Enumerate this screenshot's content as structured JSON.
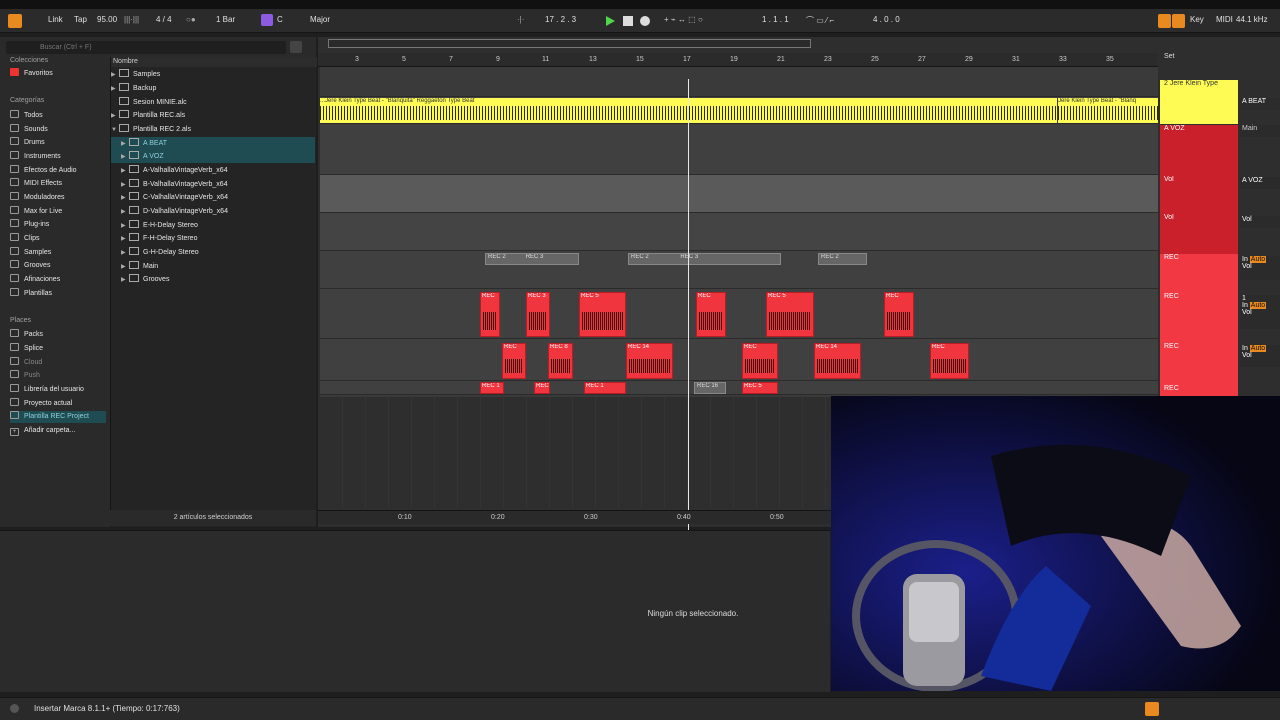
{
  "transport": {
    "link": "Link",
    "tap": "Tap",
    "tempo": "95.00",
    "meter": "4 / 4",
    "quant": "1 Bar",
    "key": "C",
    "scale": "Major",
    "position": "17 . 2 . 3",
    "loop_start": "1 . 1 . 1",
    "loop_len": "4 . 0 . 0",
    "key_label": "Key",
    "midi_label": "MIDI",
    "sample_rate": "44.1 kHz"
  },
  "browser": {
    "search_placeholder": "Buscar (Ctrl + F)",
    "collections_title": "Colecciones",
    "favorites": "Favoritos",
    "categories_title": "Categorías",
    "categories": [
      "Todos",
      "Sounds",
      "Drums",
      "Instruments",
      "Efectos de Audio",
      "MIDI Effects",
      "Moduladores",
      "Max for Live",
      "Plug-ins",
      "Clips",
      "Samples",
      "Grooves",
      "Afinaciones",
      "Plantillas"
    ],
    "places_title": "Places",
    "places": [
      "Packs",
      "Splice",
      "Cloud",
      "Push",
      "Librería del usuario",
      "Proyecto actual",
      "Plantilla REC Project",
      "Añadir carpeta..."
    ],
    "name_header": "Nombre",
    "files": [
      "Samples",
      "Backup",
      "Sesion MINIE.alc",
      "Plantilla REC.als",
      "Plantilla REC 2.als",
      "A BEAT",
      "A VOZ",
      "A-ValhallaVintageVerb_x64",
      "B-ValhallaVintageVerb_x64",
      "C-ValhallaVintageVerb_x64",
      "D-ValhallaVintageVerb_x64",
      "E-H-Delay Stereo",
      "F-H-Delay Stereo",
      "G-H-Delay Stereo",
      "Main",
      "Grooves"
    ],
    "status": "2 artículos seleccionados"
  },
  "ruler": {
    "bars": [
      "3",
      "5",
      "7",
      "9",
      "11",
      "13",
      "15",
      "17",
      "19",
      "21",
      "23",
      "25",
      "27",
      "29",
      "31",
      "33",
      "35"
    ],
    "set_label": "Set",
    "times": [
      "0:10",
      "0:20",
      "0:30",
      "0:40",
      "0:50"
    ]
  },
  "clips": {
    "beat_title": "...Jere Klein Type Beat - \"Blanquita\" Reggaeton Type Beat",
    "beat_title2": "Jere Klein Type Beat - \"Blanq",
    "rec2a": "REC 2",
    "rec3a": "REC 3",
    "rec2b": "REC 2",
    "rec3b": "REC 3",
    "rec2c": "REC 2",
    "red_labels": [
      "REC",
      "REC 3",
      "REC 5",
      "REC",
      "REC",
      "REC 5",
      "REC",
      "REC",
      "REC",
      "REC 8",
      "REC 14",
      "REC 1",
      "REC",
      "REC",
      "REC 14",
      "REC 1",
      "REC",
      "REC",
      "REC 1",
      "REC",
      "REC 1",
      "REC",
      "REC 16",
      "REC 5"
    ]
  },
  "mixer": {
    "track1": "2 Jere Klein Type",
    "track1_io": "A BEAT",
    "track2": "A VOZ",
    "track2_io": "Main",
    "track3": "Vol",
    "track3_io": "A VOZ",
    "track4": "Vol",
    "track4_io": "Vol",
    "rec": "REC",
    "in": "In",
    "auto": "Auto",
    "vol": "Vol",
    "num1": "1"
  },
  "detail": {
    "message": "Ningún clip seleccionado."
  },
  "status": {
    "text": "Insertar Marca 8.1.1+ (Tiempo: 0:17:763)"
  }
}
